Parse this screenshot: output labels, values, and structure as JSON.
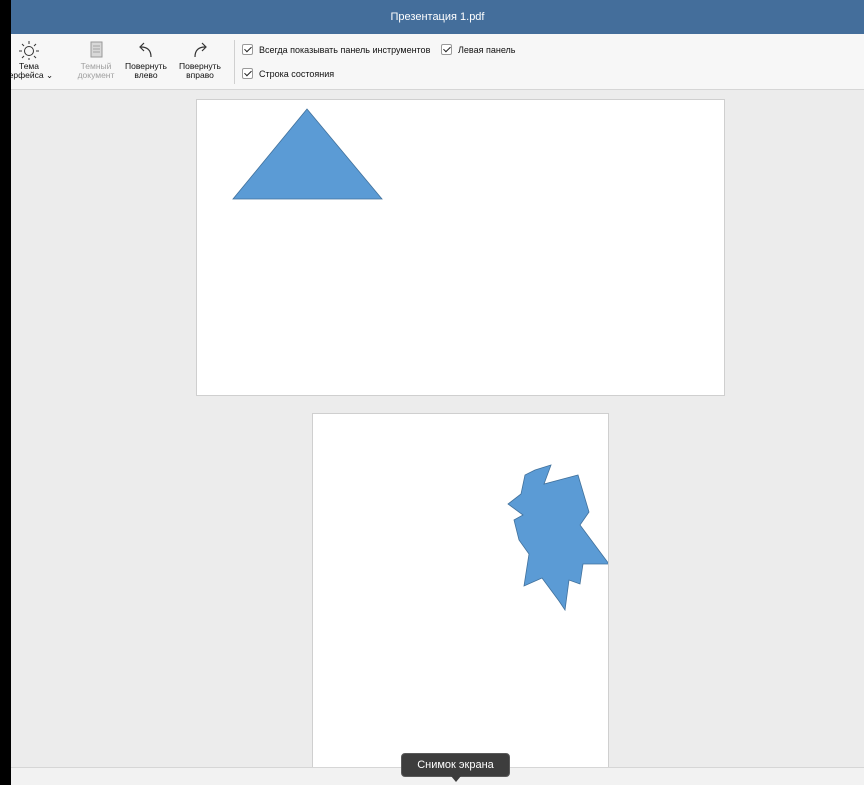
{
  "window": {
    "title": "Презентация 1.pdf"
  },
  "toolbar": {
    "theme": {
      "line1": "Тема",
      "line2": "терфейса ⌄"
    },
    "dark_doc": {
      "line1": "Темный",
      "line2": "документ"
    },
    "rotate_left": {
      "line1": "Повернуть",
      "line2": "влево"
    },
    "rotate_right": {
      "line1": "Повернуть",
      "line2": "вправо"
    },
    "checkboxes": {
      "always_show_toolbar": {
        "label": "Всегда показывать панель инструментов",
        "checked": true
      },
      "left_panel": {
        "label": "Левая панель",
        "checked": true
      },
      "status_bar": {
        "label": "Строка состояния",
        "checked": true
      }
    }
  },
  "document": {
    "pages": [
      {
        "shape": "triangle",
        "fill": "#5b9bd5"
      },
      {
        "shape": "star-burst",
        "fill": "#5b9bd5"
      }
    ]
  },
  "tooltip": {
    "text": "Снимок экрана"
  }
}
